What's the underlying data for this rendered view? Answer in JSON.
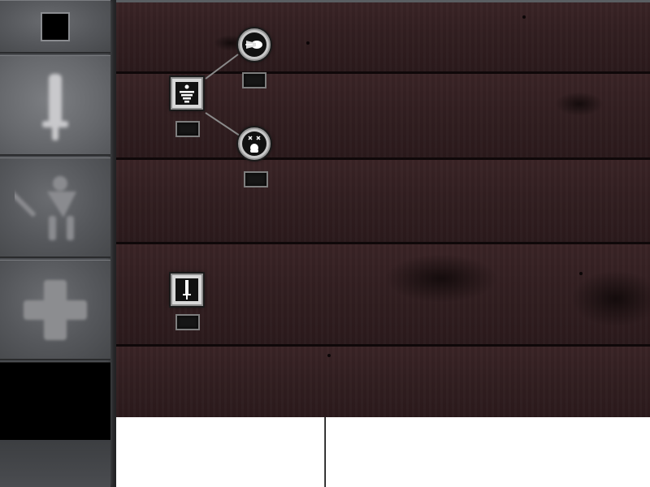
{
  "sidebar": {
    "categories": [
      {
        "name": "color-swatch",
        "icon": "black-square-icon"
      },
      {
        "name": "melee",
        "icon": "sword-icon",
        "active": true
      },
      {
        "name": "warrior",
        "icon": "warrior-icon"
      },
      {
        "name": "healing",
        "icon": "cross-icon"
      },
      {
        "name": "empty",
        "icon": ""
      }
    ]
  },
  "skill_tree": {
    "nodes": [
      {
        "id": "tier-root",
        "icon": "stacked-bars-icon",
        "shape": "square",
        "level": ""
      },
      {
        "id": "dash",
        "icon": "comet-icon",
        "shape": "round",
        "level": ""
      },
      {
        "id": "stun",
        "icon": "dazed-face-icon",
        "shape": "round",
        "level": ""
      },
      {
        "id": "blade",
        "icon": "sword-icon",
        "shape": "square",
        "level": ""
      }
    ]
  },
  "colors": {
    "wood": "#321f21",
    "sidebar": "#4a4c50",
    "panel": "#ffffff"
  }
}
